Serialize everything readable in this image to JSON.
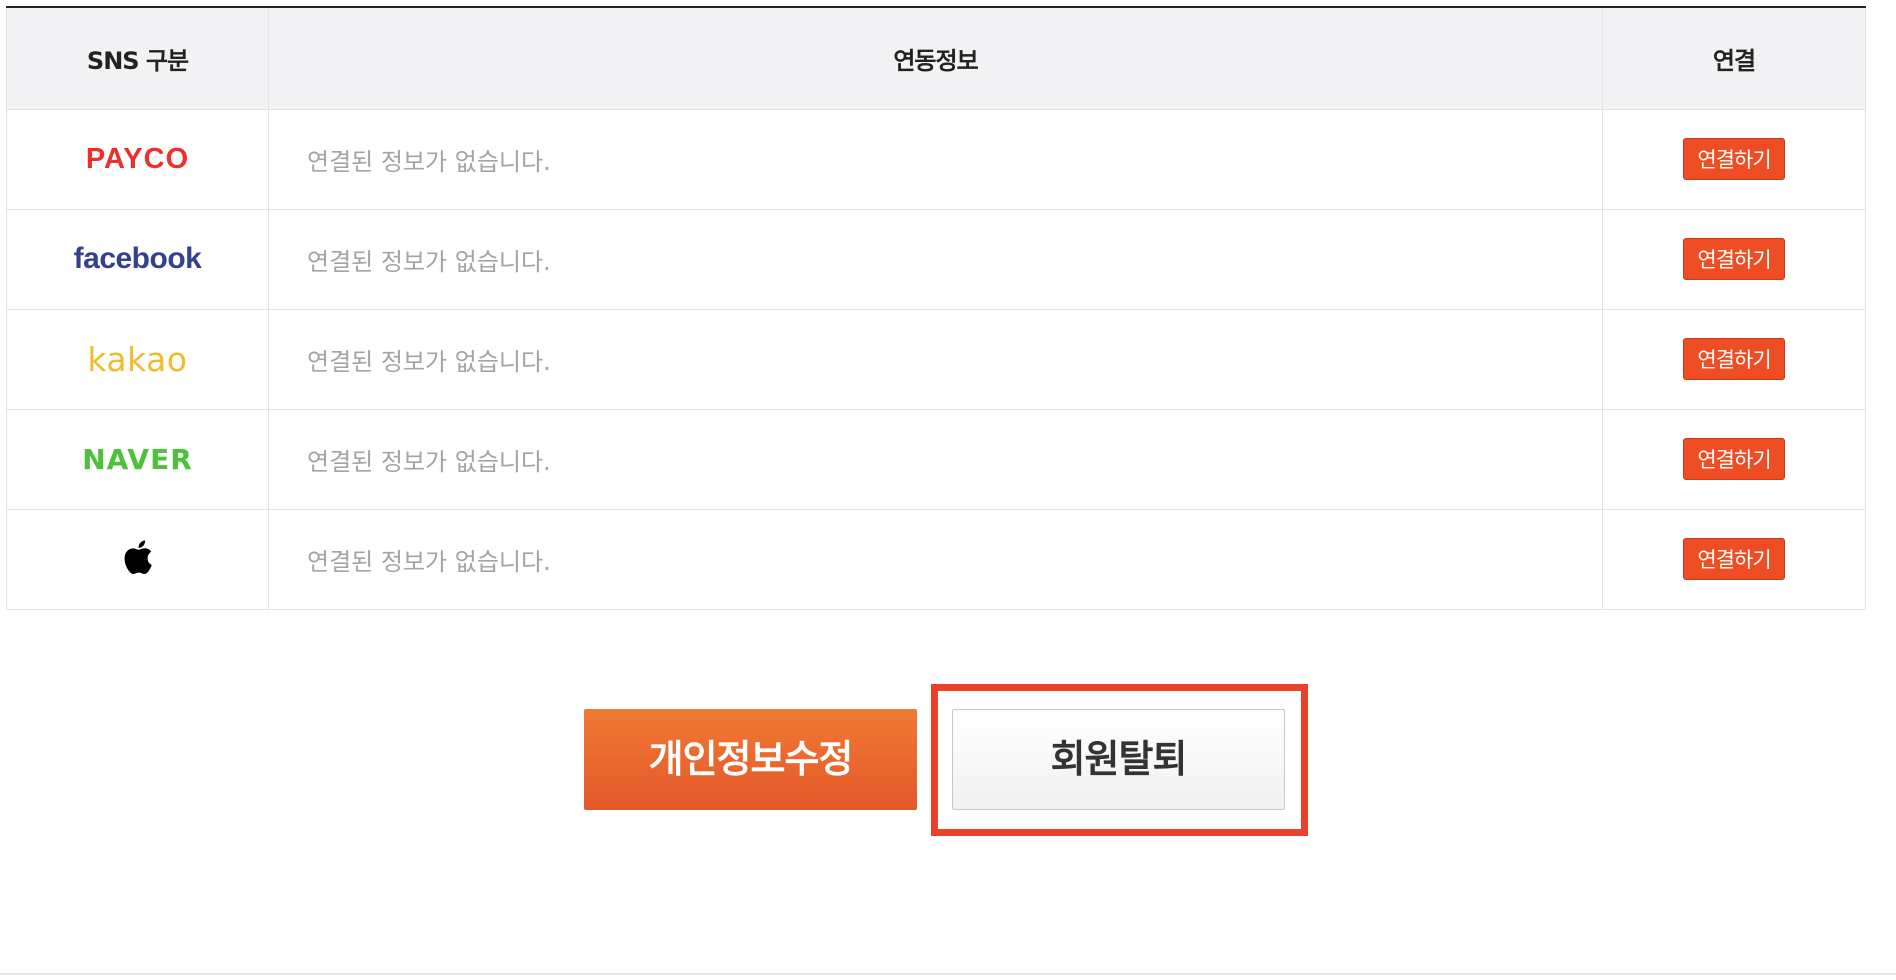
{
  "table": {
    "headers": [
      "SNS 구분",
      "연동정보",
      "연결"
    ],
    "rows": [
      {
        "service": "PAYCO",
        "logo_text": "PAYCO",
        "info": "연결된 정보가 없습니다.",
        "button": "연결하기"
      },
      {
        "service": "facebook",
        "logo_text": "facebook",
        "info": "연결된 정보가 없습니다.",
        "button": "연결하기"
      },
      {
        "service": "kakao",
        "logo_text": "kakao",
        "info": "연결된 정보가 없습니다.",
        "button": "연결하기"
      },
      {
        "service": "NAVER",
        "logo_text": "NAVER",
        "info": "연결된 정보가 없습니다.",
        "button": "연결하기"
      },
      {
        "service": "Apple",
        "logo_icon": "apple-icon",
        "info": "연결된 정보가 없습니다.",
        "button": "연결하기"
      }
    ]
  },
  "actions": {
    "edit_label": "개인정보수정",
    "withdraw_label": "회원탈퇴"
  },
  "colors": {
    "accent": "#ef4e25",
    "payco": "#ee2f2b",
    "facebook": "#34418f",
    "kakao": "#f0bb2d",
    "naver": "#4cc139",
    "highlight": "#e8412c"
  }
}
